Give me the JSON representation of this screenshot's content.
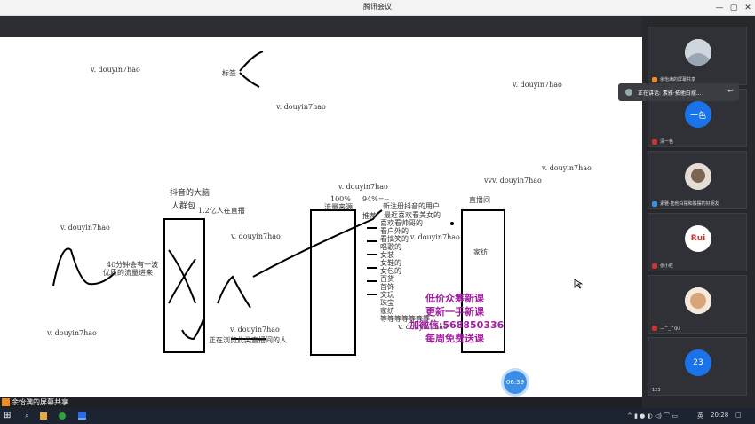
{
  "window": {
    "title": "腾讯会议",
    "minimize": "—",
    "restore": "▢",
    "close": "✕"
  },
  "canvas": {
    "watermarks": [
      "v. douyin7hao",
      "v. douyin7hao",
      "v. douyin7hao",
      "v. douyin7hao",
      "vvv. douyin7hao",
      "v. douyin7hao",
      "v. douyin7hao",
      "v. douyin7hao",
      "v. douyin7hao",
      "v. douyin7hao",
      "v. douyin7hao",
      "v. douyin7hao"
    ],
    "notes": {
      "tag": "标签",
      "brain": "抖音的大脑",
      "crowd": "人群包",
      "live_count": "1.2亿人在直播",
      "flow_note": "40分钟会有一波",
      "flow_note2": "优质的流量进来",
      "watching": "正在浏览此类直播间的人",
      "percent": "100%",
      "traffic_source": "流量来源",
      "pct94": "94%=--",
      "recommend": "推荐",
      "new_users": "新注册抖音的用户",
      "recent": "最近喜欢看美女的",
      "handsome": "喜欢看帅哥的",
      "outdoor": "看户外的",
      "funny": "看搞笑的",
      "singing": "唱歌的",
      "womens": "女装",
      "shoes": "女鞋的",
      "bags": "女包的",
      "goods": "百货",
      "jewelry": "首饰",
      "toys": "文玩",
      "treasure": "珠宝",
      "home": "家纺",
      "etc": "等等等等等等等",
      "live_room": "直播间",
      "home2": "家纺"
    },
    "promo": [
      "低价众筹新课",
      "更新一手新课",
      "加微信:568850336",
      "每周免费送课"
    ],
    "timer": "06:39"
  },
  "participants": [
    {
      "name": "余怡满的屏幕共享",
      "avatar": ""
    },
    {
      "name": "清一色",
      "avatar": "一色"
    },
    {
      "name": "素雅·拓他白摆和搬摆的好朋友",
      "avatar": ""
    },
    {
      "name": "张小胜",
      "avatar": "Rui"
    },
    {
      "name": "—^_^qu",
      "avatar": ""
    },
    {
      "name": "123",
      "avatar": "23"
    }
  ],
  "toast": {
    "text": "正在讲话: 素雅·拓他白摆...",
    "close": "↩"
  },
  "share_bar": {
    "label": "余怡满的屏幕共享"
  },
  "taskbar": {
    "start": "⊞",
    "search": "⌕",
    "clock": "20:28",
    "ime": "英"
  },
  "colors": {
    "accent": "#3a8ee6",
    "promo": "#a020a0"
  }
}
